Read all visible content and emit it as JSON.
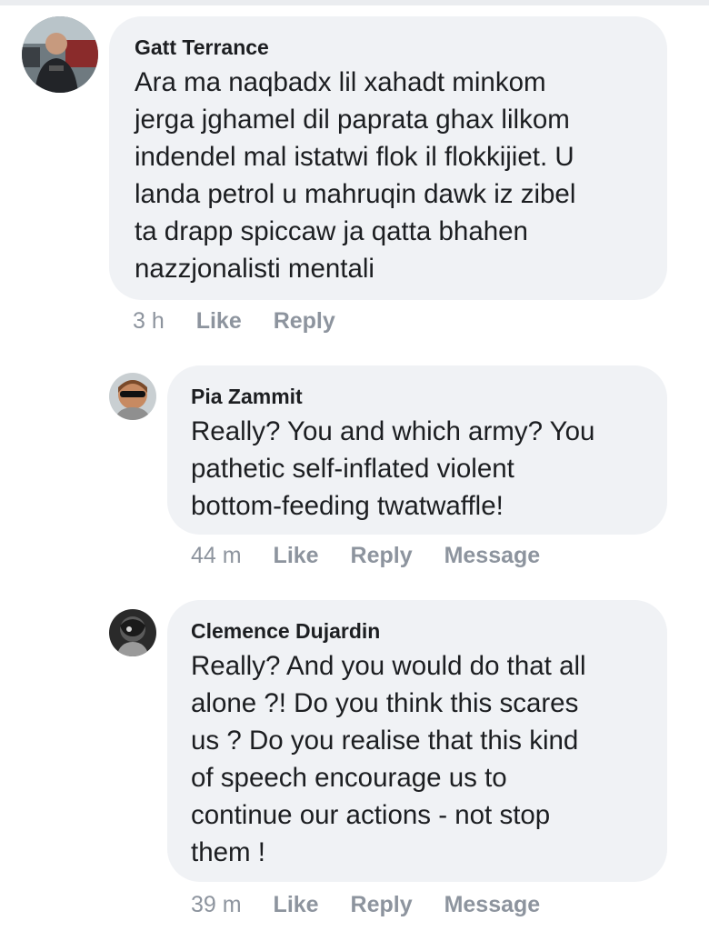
{
  "comments": [
    {
      "author": "Gatt Terrance",
      "text": "Ara ma naqbadx lil xahadt minkom\njerga jghamel dil paprata ghax lilkom\nindendel mal istatwi flok il flokkijiet. U\nlanda petrol u mahruqin dawk iz zibel\nta drapp spiccaw ja qatta bhahen\nnazzjonalisti mentali",
      "time": "3 h",
      "like_label": "Like",
      "reply_label": "Reply"
    },
    {
      "author": "Pia Zammit",
      "text": "Really? You and which army? You\npathetic self-inflated violent\nbottom-feeding twatwaffle!",
      "time": "44 m",
      "like_label": "Like",
      "reply_label": "Reply",
      "message_label": "Message"
    },
    {
      "author": "Clemence Dujardin",
      "text": "Really? And you would do that all\nalone ?! Do you think this scares\nus ? Do you realise that this kind\nof speech encourage us to\ncontinue our actions - not stop\nthem !",
      "time": "39 m",
      "like_label": "Like",
      "reply_label": "Reply",
      "message_label": "Message"
    }
  ],
  "colors": {
    "bubble_bg": "#f0f2f5",
    "text": "#1c1e21",
    "meta": "#8d949e"
  }
}
